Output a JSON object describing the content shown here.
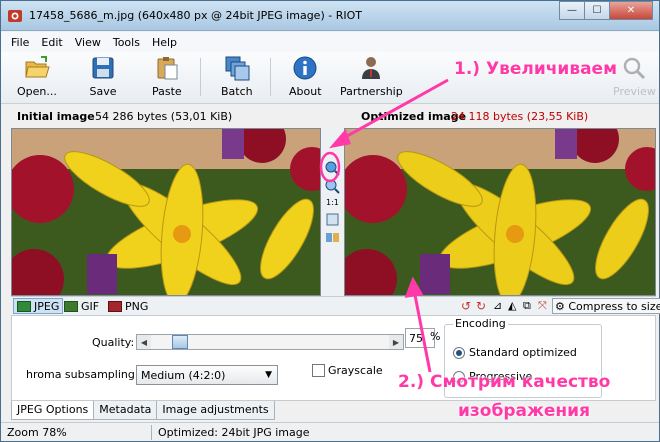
{
  "window": {
    "title": "17458_5686_m.jpg (640x480 px @ 24bit JPEG image) - RIOT"
  },
  "menu": [
    "File",
    "Edit",
    "View",
    "Tools",
    "Help"
  ],
  "toolbar": {
    "open": "Open...",
    "save": "Save",
    "paste": "Paste",
    "batch": "Batch",
    "about": "About",
    "partnership": "Partnership",
    "preview": "Preview"
  },
  "info": {
    "initial_label": "Initial image",
    "initial_value": "54 286 bytes (53,01 KiB)",
    "optimized_label": "Optimized image",
    "optimized_value": "24 118 bytes (23,55 KiB)"
  },
  "mid_strip": {
    "one_to_one": "1:1"
  },
  "format_tabs": [
    "JPEG",
    "GIF",
    "PNG"
  ],
  "format_actions": {
    "compress": "Compress to size"
  },
  "settings": {
    "quality_label": "Quality:",
    "quality_value": "75",
    "quality_percent": "%",
    "quality_level": 0.75,
    "chroma_label": "hroma subsampling:",
    "chroma_value": "Medium (4:2:0)",
    "grayscale_label": "Grayscale",
    "encoding_title": "Encoding",
    "encoding_options": [
      "Standard optimized",
      "Progressive"
    ],
    "encoding_selected": "Standard optimized"
  },
  "bottom_tabs": [
    "JPEG Options",
    "Metadata",
    "Image adjustments"
  ],
  "status": {
    "zoom": "Zoom 78%",
    "message": "Optimized: 24bit JPG image"
  },
  "annotations": {
    "step1": "1.) Увеличиваем",
    "step2_line1": "2.) Смотрим качество",
    "step2_line2": "изображения"
  },
  "colors": {
    "annotation": "#ff3aa8",
    "optimized_value": "#c00000"
  }
}
